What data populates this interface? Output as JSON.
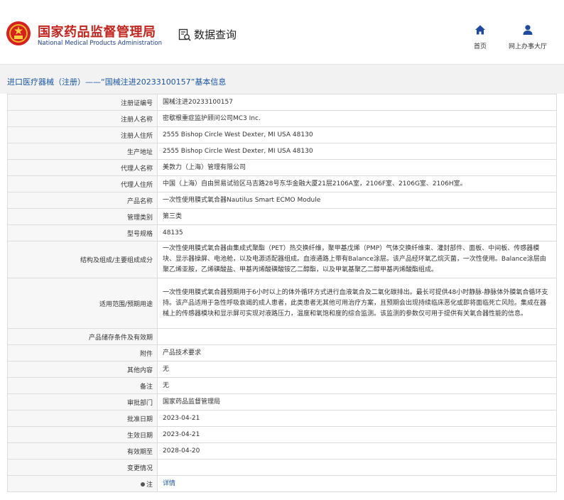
{
  "header": {
    "logo_cn": "国家药品监督管理局",
    "logo_en": "National Medical Products Administration",
    "query_label": "数据查询",
    "nav": [
      {
        "label": "首页",
        "icon": "home-icon"
      },
      {
        "label": "网上办事大厅",
        "icon": "user-icon"
      }
    ]
  },
  "breadcrumb": "进口医疗器械（注册）——“国械注进20233100157”基本信息",
  "rows": [
    {
      "label": "注册证编号",
      "value": "国械注进20233100157"
    },
    {
      "label": "注册人名称",
      "value": "密歇根重症监护顾问公司MC3 Inc."
    },
    {
      "label": "注册人住所",
      "value": "2555 Bishop Circle West Dexter, MI USA 48130"
    },
    {
      "label": "生产地址",
      "value": "2555 Bishop Circle West Dexter, MI USA 48130"
    },
    {
      "label": "代理人名称",
      "value": "美敦力（上海）管理有限公司"
    },
    {
      "label": "代理人住所",
      "value": "中国（上海）自由贸易试验区马吉路28号东华金融大厦21层2106A室，2106F室、2106G室、2106H室。"
    },
    {
      "label": "产品名称",
      "value": "一次性使用膜式氧合器Nautilus Smart ECMO Module"
    },
    {
      "label": "管理类别",
      "value": "第三类"
    },
    {
      "label": "型号规格",
      "value": "48135"
    },
    {
      "label": "结构及组成/主要组成成分",
      "value": "一次性使用膜式氧合器由集成式聚酯（PET）热交换纤维，聚甲基戊烯（PMP）气体交换纤维束、灌封部件、面板、中间板、传感器模块、显示器操屏、电池舱，以及电源适配器组成。血液通路上带有Balance涂层。该产品经环氧乙烷灭菌，一次性使用。Balance涂层由聚乙烯亚胺，乙烯磺酸盐、甲基丙烯酸磺酸铵乙二醇酯，以及甲氧基聚乙二醇甲基丙烯酸酯组成。"
    },
    {
      "label": "适用范围/预期用途",
      "value": "一次性使用膜式氧合器预期用于6小时以上的体外循环方式进行血液氧合及二氧化碳排出。最长可提供48小时静脉-静脉体外膜氧合循环支持。该产品适用于急性呼吸衰竭的成人患者，此类患者无其他可用治疗方案，且预期会出现持续临床恶化或即将面临死亡风险。集成在器械上的传感器模块和显示屏可实现对液路压力，温度和氧饱和度的综合监测。该监测的参数仅可用于提供有关氧合器性能的信息。"
    },
    {
      "label": "产品储存条件及有效期",
      "value": ""
    },
    {
      "label": "附件",
      "value": "产品技术要求"
    },
    {
      "label": "其他内容",
      "value": "无"
    },
    {
      "label": "备注",
      "value": "无"
    },
    {
      "label": "审批部门",
      "value": "国家药品监督管理局"
    },
    {
      "label": "批准日期",
      "value": "2023-04-21"
    },
    {
      "label": "生效日期",
      "value": "2023-04-21"
    },
    {
      "label": "有效期至",
      "value": "2028-04-20"
    },
    {
      "label": "变更情况",
      "value": ""
    },
    {
      "label": "注",
      "value": "详情"
    }
  ]
}
